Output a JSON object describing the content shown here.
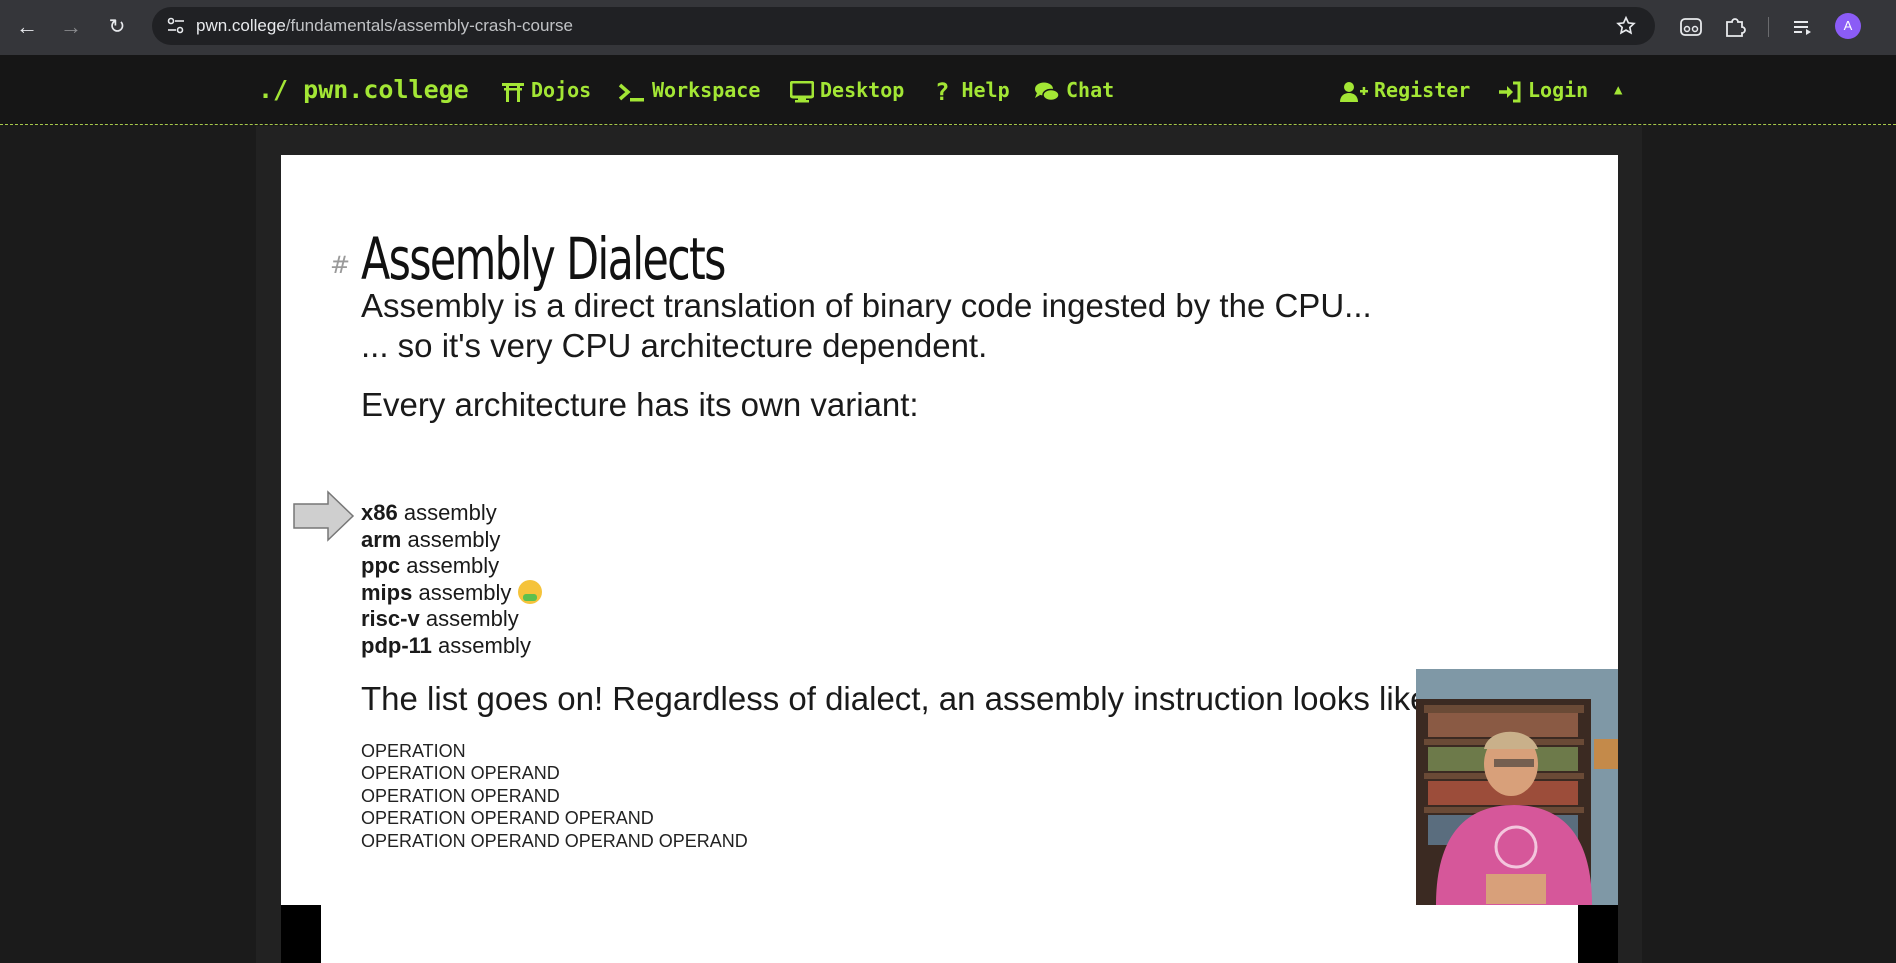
{
  "browser": {
    "url_host": "pwn.college",
    "url_path": "/fundamentals/assembly-crash-course",
    "avatar_letter": "A"
  },
  "navbar": {
    "brand": "./ pwn.college",
    "items": [
      {
        "label": "Dojos",
        "icon": "torii-gate-icon"
      },
      {
        "label": "Workspace",
        "icon": "terminal-icon"
      },
      {
        "label": "Desktop",
        "icon": "desktop-icon"
      },
      {
        "label": "Help",
        "icon": "question-icon"
      },
      {
        "label": "Chat",
        "icon": "chat-icon"
      }
    ],
    "right": [
      {
        "label": "Register",
        "icon": "user-plus-icon"
      },
      {
        "label": "Login",
        "icon": "sign-in-icon"
      }
    ],
    "accent": "#a3e635"
  },
  "slide": {
    "hash": "#",
    "title": "Assembly Dialects",
    "line1": "Assembly is a direct translation of binary code ingested by the CPU...",
    "line2": "... so it's very CPU architecture dependent.",
    "line3": "Every architecture has its own variant:",
    "variants": [
      {
        "name": "x86",
        "suffix": " assembly"
      },
      {
        "name": "arm",
        "suffix": " assembly"
      },
      {
        "name": "ppc",
        "suffix": " assembly"
      },
      {
        "name": "mips",
        "suffix": " assembly"
      },
      {
        "name": "risc-v",
        "suffix": " assembly"
      },
      {
        "name": "pdp-11",
        "suffix": " assembly"
      }
    ],
    "line4": "The list goes on! Regardless of dialect, an assembly instruction looks like",
    "ops": [
      "OPERATION",
      "OPERATION OPERAND",
      "OPERATION OPERAND",
      "OPERATION OPERAND OPERAND",
      "OPERATION OPERAND OPERAND OPERAND"
    ]
  }
}
